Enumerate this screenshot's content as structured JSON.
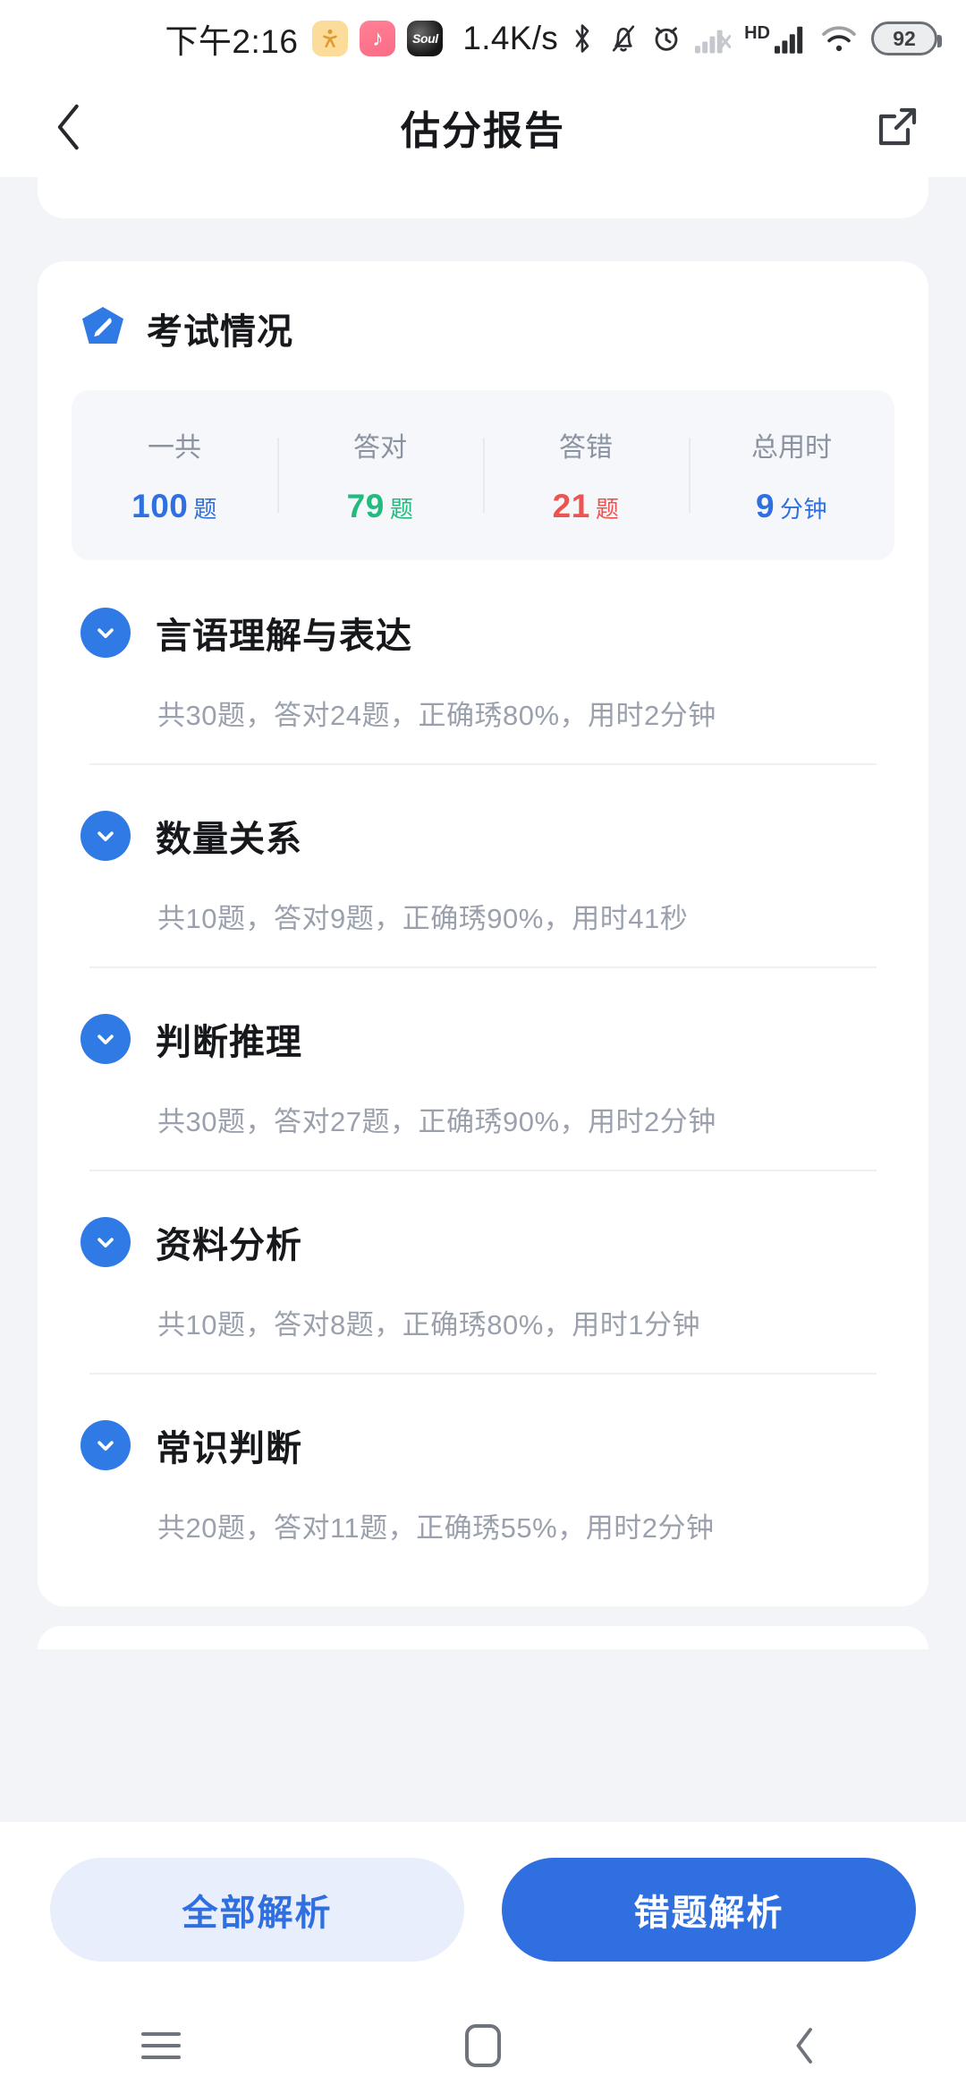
{
  "status_bar": {
    "time": "下午2:16",
    "network_speed": "1.4K/s",
    "battery": "92",
    "app_icons": [
      {
        "name": "keep-icon",
        "glyph": "人"
      },
      {
        "name": "music-icon",
        "glyph": "♪"
      },
      {
        "name": "soul-app-icon",
        "glyph": "Soul"
      }
    ],
    "icons": [
      "bluetooth-icon",
      "silent-icon",
      "alarm-icon",
      "signal-1-icon",
      "hd-icon",
      "signal-2-icon",
      "wifi-icon",
      "battery-icon"
    ]
  },
  "app_bar": {
    "back": "back-icon",
    "title": "估分报告",
    "share": "share-icon"
  },
  "exam_section": {
    "title": "考试情况",
    "badge_icon": "pen-badge-icon",
    "stats": [
      {
        "label": "一共",
        "value": "100",
        "unit": "题",
        "color_class": "v-blue"
      },
      {
        "label": "答对",
        "value": "79",
        "unit": "题",
        "color_class": "v-green"
      },
      {
        "label": "答错",
        "value": "21",
        "unit": "题",
        "color_class": "v-red"
      },
      {
        "label": "总用时",
        "value": "9",
        "unit": "分钟",
        "color_class": "v-blue"
      }
    ],
    "categories": [
      {
        "name": "言语理解与表达",
        "detail": "共30题，答对24题，正确琇80%，用时2分钟",
        "total": 30,
        "correct": 24,
        "accuracy": "80%",
        "time": "2分钟"
      },
      {
        "name": "数量关系",
        "detail": "共10题，答对9题，正确琇90%，用时41秒",
        "total": 10,
        "correct": 9,
        "accuracy": "90%",
        "time": "41秒"
      },
      {
        "name": "判断推理",
        "detail": "共30题，答对27题，正确琇90%，用时2分钟",
        "total": 30,
        "correct": 27,
        "accuracy": "90%",
        "time": "2分钟"
      },
      {
        "name": "资料分析",
        "detail": "共10题，答对8题，正确琇80%，用时1分钟",
        "total": 10,
        "correct": 8,
        "accuracy": "80%",
        "time": "1分钟"
      },
      {
        "name": "常识判断",
        "detail": "共20题，答对11题，正确琇55%，用时2分钟",
        "total": 20,
        "correct": 11,
        "accuracy": "55%",
        "time": "2分钟"
      }
    ]
  },
  "actions": {
    "secondary_label": "全部解析",
    "primary_label": "错题解析"
  },
  "nav_bar": {
    "recents": "recents-icon",
    "home": "home-icon",
    "back": "back-icon"
  },
  "colors": {
    "accent_blue": "#2f6fe0",
    "chevron_blue": "#2f7ae5",
    "green": "#21bb7e",
    "red": "#ef5350",
    "page_bg": "#f2f4f7",
    "card_bg": "#ffffff",
    "stats_bg": "#f5f7fa",
    "muted_text": "#9aa1ad"
  }
}
